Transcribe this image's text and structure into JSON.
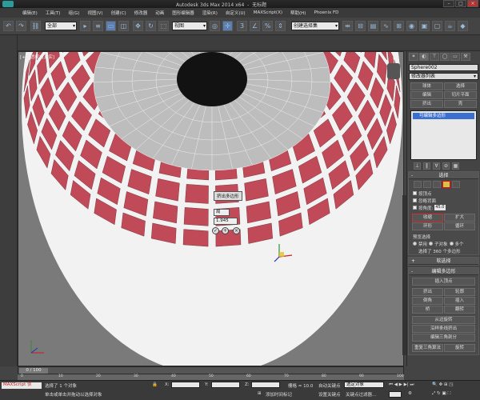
{
  "window": {
    "title": "Autodesk 3ds Max  2014 x64",
    "file": "无标题"
  },
  "menu": [
    "编辑(E)",
    "工具(T)",
    "组(G)",
    "视图(V)",
    "创建(C)",
    "修改器",
    "动画",
    "图形编辑器",
    "渲染(R)",
    "自定义(U)",
    "MAXScript(X)",
    "帮助(H)",
    "Phoenix FD"
  ],
  "toolbar": {
    "filter_select": "全部",
    "coord_select": "视图",
    "selection_set_select": "创建选择集"
  },
  "viewport": {
    "label": "[+] [透视] [真实]",
    "caddy": {
      "title": "挤出多边形",
      "type_value": "局",
      "height_value": "1.945"
    }
  },
  "command_panel": {
    "object_name": "Sphere002",
    "modifier_list": "修改器列表",
    "buttons": [
      "球体",
      "选择",
      "编辑",
      "切片平面",
      "挤出",
      "壳"
    ],
    "stack_item": "可编辑多边形",
    "selection_rollout": {
      "title": "选择",
      "by_vertex": "按顶点",
      "ignore_backfacing": "忽略背面",
      "by_angle": "按角度:",
      "by_angle_value": "45.0",
      "shrink": "收缩",
      "grow": "扩大",
      "ring": "环形",
      "loop": "循环",
      "preview_title": "预览选择",
      "preview_off": "禁用",
      "preview_subobj": "子对象",
      "preview_multi": "多个",
      "status": "选择了 360 个多边形"
    },
    "soft_selection": "软选择",
    "edit_polygons": {
      "title": "编辑多边形",
      "insert_vertex": "插入顶点",
      "extrude": "挤出",
      "outline": "轮廓",
      "bevel": "倒角",
      "inset": "插入",
      "bridge": "桥",
      "flip": "翻转",
      "hinge": "从边旋转",
      "extrude_along_spline": "沿样条线挤出",
      "edit_triangulation": "编辑三角剖分",
      "retriangulate": "重复三角算法",
      "turn": "旋转"
    }
  },
  "timeline": {
    "slider": "0 / 100",
    "ticks": [
      "0",
      "10",
      "20",
      "30",
      "40",
      "50",
      "60",
      "70",
      "80",
      "90",
      "100"
    ]
  },
  "status": {
    "maxscript": "MAXScript 侦",
    "message1": "选择了 1 个对象",
    "message2": "单击或单击并拖动以选择对象",
    "x_label": "X:",
    "y_label": "Y:",
    "z_label": "Z:",
    "grid": "栅格 = 10.0",
    "auto_key": "自动关键点",
    "selected": "选定对象",
    "set_key": "设置关键点",
    "key_filters": "关键点过滤器...",
    "add_time_tag": "添加时间标记"
  },
  "colors": {
    "face_red": "#c04a58",
    "wire_white": "#f2f2f2",
    "sphere_gray": "#bdbdbd",
    "viewport_bg": "#7a7a7a"
  }
}
